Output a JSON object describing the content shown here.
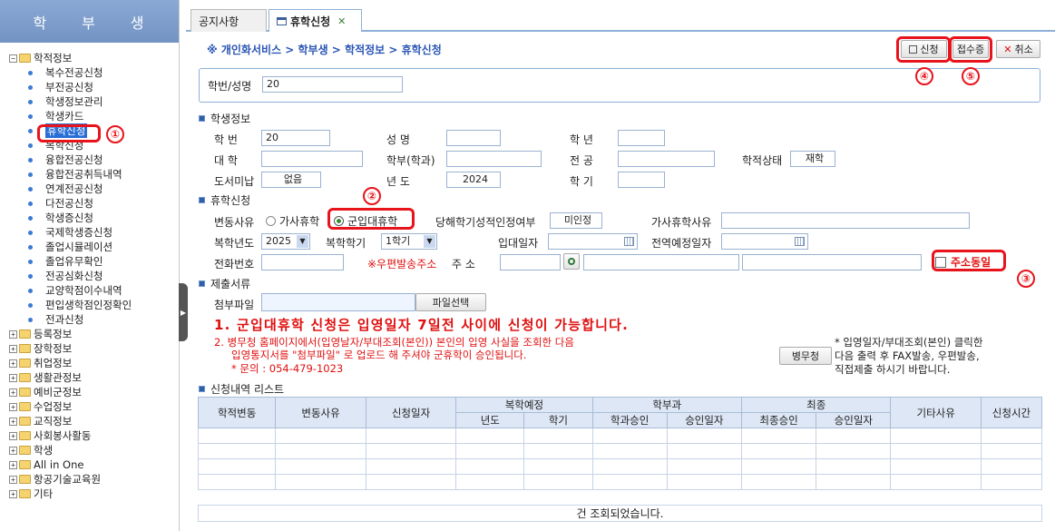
{
  "sidebar": {
    "title_chars": [
      "학",
      "부",
      "생"
    ],
    "tree": [
      {
        "type": "folder",
        "expanded": true,
        "label": "학적정보"
      },
      {
        "type": "leaf",
        "label": "복수전공신청"
      },
      {
        "type": "leaf",
        "label": "부전공신청"
      },
      {
        "type": "leaf",
        "label": "학생정보관리"
      },
      {
        "type": "leaf",
        "label": "학생카드"
      },
      {
        "type": "leaf",
        "label": "휴학신청",
        "selected": true
      },
      {
        "type": "leaf",
        "label": "복학신청"
      },
      {
        "type": "leaf",
        "label": "융합전공신청"
      },
      {
        "type": "leaf",
        "label": "융합전공취득내역"
      },
      {
        "type": "leaf",
        "label": "연계전공신청"
      },
      {
        "type": "leaf",
        "label": "다전공신청"
      },
      {
        "type": "leaf",
        "label": "학생증신청"
      },
      {
        "type": "leaf",
        "label": "국제학생증신청"
      },
      {
        "type": "leaf",
        "label": "졸업시뮬레이션"
      },
      {
        "type": "leaf",
        "label": "졸업유무확인"
      },
      {
        "type": "leaf",
        "label": "전공심화신청"
      },
      {
        "type": "leaf",
        "label": "교양학점이수내역"
      },
      {
        "type": "leaf",
        "label": "편입생학점인정확인"
      },
      {
        "type": "leaf",
        "label": "전과신청"
      },
      {
        "type": "folder",
        "expanded": false,
        "label": "등록정보"
      },
      {
        "type": "folder",
        "expanded": false,
        "label": "장학정보"
      },
      {
        "type": "folder",
        "expanded": false,
        "label": "취업정보"
      },
      {
        "type": "folder",
        "expanded": false,
        "label": "생활관정보"
      },
      {
        "type": "folder",
        "expanded": false,
        "label": "예비군정보"
      },
      {
        "type": "folder",
        "expanded": false,
        "label": "수업정보"
      },
      {
        "type": "folder",
        "expanded": false,
        "label": "교직정보"
      },
      {
        "type": "folder",
        "expanded": false,
        "label": "사회봉사활동"
      },
      {
        "type": "folder",
        "expanded": false,
        "label": "학생"
      },
      {
        "type": "folder",
        "expanded": false,
        "label": "All in One"
      },
      {
        "type": "folder",
        "expanded": false,
        "label": "항공기술교육원"
      },
      {
        "type": "folder",
        "expanded": false,
        "label": "기타"
      }
    ]
  },
  "tabs": [
    {
      "label": "공지사항",
      "active": false
    },
    {
      "label": "휴학신청",
      "active": true,
      "icon": "window-icon",
      "close": "✕"
    }
  ],
  "breadcrumb": "※ 개인화서비스 > 학부생 > 학적정보 > 휴학신청",
  "toolbar": {
    "apply": "신청",
    "receipt": "접수증",
    "cancel": "취소"
  },
  "search": {
    "label": "학번/성명",
    "value": "20"
  },
  "student": {
    "section": "학생정보",
    "id_label": "학      번",
    "id_value": "20",
    "name_label": "성        명",
    "name_value": "",
    "year_label": "학        년",
    "year_value": "",
    "college_label": "대      학",
    "college_value": "",
    "dept_label": "학부(학과)",
    "dept_value": "",
    "major_label": "전        공",
    "major_value": "",
    "status_label": "학적상태",
    "status_value": "재학",
    "library_label": "도서미납",
    "library_value": "없음",
    "acad_year_label": "년        도",
    "acad_year_value": "2024",
    "term_label": "학        기",
    "term_value": ""
  },
  "leave": {
    "section": "휴학신청",
    "reason_label": "변동사유",
    "opt_family": "가사휴학",
    "opt_military": "군입대휴학",
    "grade_check_label": "당해학기성적인정여부",
    "grade_check_value": "미인정",
    "family_reason_label": "가사휴학사유",
    "return_year_label": "복학년도",
    "return_year_value": "2025",
    "return_term_label": "복학학기",
    "return_term_value": "1학기",
    "enlist_label": "입대일자",
    "discharge_label": "전역예정일자",
    "phone_label": "전화번호",
    "postal_note": "※우편발송주소",
    "addr_label": "주        소",
    "same_addr_label": "주소동일"
  },
  "submit": {
    "section": "제출서류",
    "file_label": "첨부파일",
    "file_button": "파일선택",
    "notice1": "1. 군입대휴학 신청은 입영일자 7일전 사이에 신청이 가능합니다.",
    "notice2a": "2. 병무청 홈페이지에서(입영날자/부대조회(본인)) 본인의 입영 사실을 조회한 다음",
    "notice2b": "입영통지서를 \"첨부파일\" 로 업로드 해 주셔야 군휴학이 승인됩니다.",
    "notice2c": "* 문의 : 054-479-1023",
    "mma_button": "병무청",
    "side_note1": "* 입영일자/부대조회(본인) 클릭한",
    "side_note2": "다음 출력 후 FAX발송, 우편발송,",
    "side_note3": "직접제출 하시기 바랍니다."
  },
  "history": {
    "section": "신청내역 리스트",
    "h_change": "학적변동",
    "h_reason": "변동사유",
    "h_date": "신청일자",
    "h_return": "복학예정",
    "h_year": "년도",
    "h_term": "학기",
    "h_dept": "학부과",
    "h_dept_approve": "학과승인",
    "h_approve_date": "승인일자",
    "h_final": "최종",
    "h_final_approve": "최종승인",
    "h_final_date": "승인일자",
    "h_other": "기타사유",
    "h_time": "신청시간",
    "status": "건 조회되었습니다."
  },
  "annotations": [
    "①",
    "②",
    "③",
    "④",
    "⑤"
  ],
  "colors": {
    "annotation": "#e8141c",
    "accent": "#2a6fd6",
    "notice": "#e01010"
  }
}
